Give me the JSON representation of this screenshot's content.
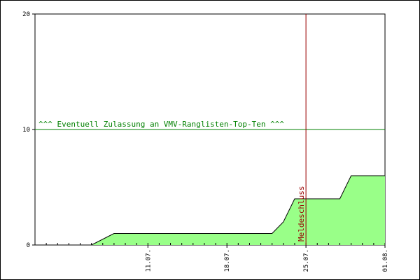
{
  "chart_data": {
    "type": "area",
    "title": "",
    "xlabel": "",
    "ylabel": "",
    "ylim": [
      0,
      20
    ],
    "x_ticks": [
      "11.07.",
      "18.07.",
      "25.07.",
      "01.08."
    ],
    "y_ticks": [
      "0",
      "10",
      "20"
    ],
    "x": [
      "04.07.",
      "06.07.",
      "08.07.",
      "21.07.",
      "22.07.",
      "23.07.",
      "24.07.",
      "28.07.",
      "29.07.",
      "01.08."
    ],
    "values": [
      0,
      0,
      1,
      1,
      1,
      2,
      4,
      4,
      6,
      6
    ],
    "fill_color": "#99ff88",
    "line_color": "#000000",
    "grid": false,
    "reference_line": {
      "value": 10,
      "label": "^^^ Eventuell Zulassung an VMV-Ranglisten-Top-Ten ^^^",
      "color": "#008000"
    },
    "deadline_line": {
      "date": "25.07.",
      "label": "Meldeschluss",
      "color": "#990000"
    }
  }
}
